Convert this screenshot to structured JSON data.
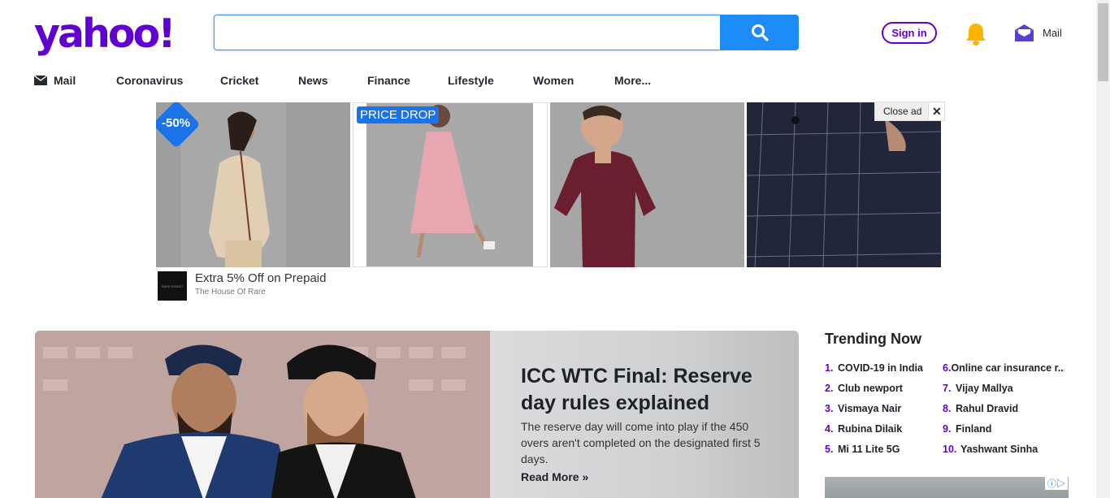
{
  "header": {
    "logo": "yahoo!",
    "search_placeholder": "",
    "signin_label": "Sign in",
    "mail_label": "Mail"
  },
  "nav": {
    "items": [
      "Mail",
      "Coronavirus",
      "Cricket",
      "News",
      "Finance",
      "Lifestyle",
      "Women",
      "More..."
    ]
  },
  "ad": {
    "badge_discount": "-50%",
    "badge_price": "PRICE DROP",
    "close_label": "Close ad",
    "title": "Extra 5% Off on Prepaid",
    "advertiser": "The House Of Rare",
    "brand_mark": "RARE RABBIT"
  },
  "hero": {
    "title": "ICC WTC Final: Reserve day rules explained",
    "description": "The reserve day will come into play if the 450 overs aren't completed on the designated first 5 days.",
    "read_more": "Read More »"
  },
  "trending": {
    "heading": "Trending Now",
    "items": [
      {
        "num": "1.",
        "label": "COVID-19 in India"
      },
      {
        "num": "2.",
        "label": "Club newport"
      },
      {
        "num": "3.",
        "label": "Vismaya Nair"
      },
      {
        "num": "4.",
        "label": "Rubina Dilaik"
      },
      {
        "num": "5.",
        "label": "Mi 11 Lite 5G"
      },
      {
        "num": "6.",
        "label": "Online car insurance r..."
      },
      {
        "num": "7.",
        "label": "Vijay Mallya"
      },
      {
        "num": "8.",
        "label": "Rahul Dravid"
      },
      {
        "num": "9.",
        "label": "Finland"
      },
      {
        "num": "10.",
        "label": "Yashwant Sinha"
      }
    ]
  },
  "colors": {
    "brand": "#6001d2",
    "search_button": "#1d8cf8",
    "ad_badge": "#1a73e8"
  }
}
